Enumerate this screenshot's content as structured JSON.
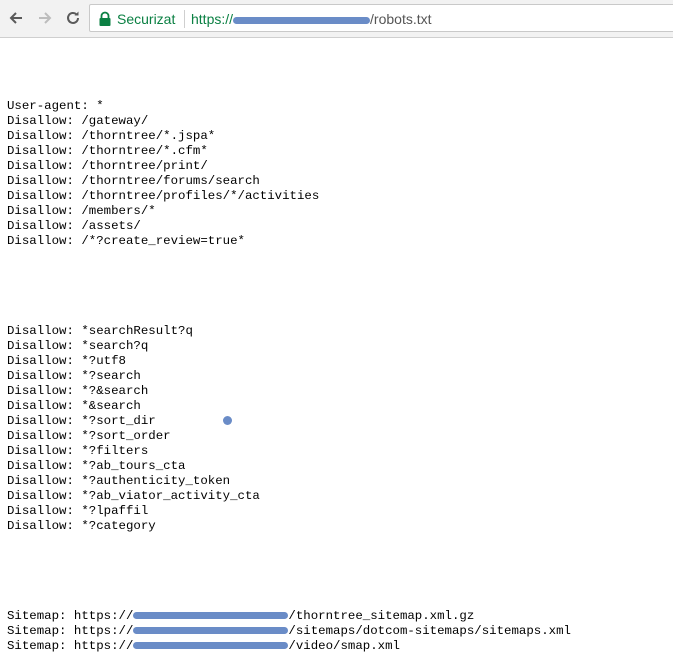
{
  "browser": {
    "security_label": "Securizat",
    "url_scheme": "https://",
    "url_path": "/robots.txt",
    "colors": {
      "secure": "#0b8043",
      "redaction": "#6a8cc7"
    },
    "icons": [
      "back-arrow-icon",
      "forward-arrow-icon",
      "reload-icon",
      "lock-icon"
    ]
  },
  "robots": {
    "block1": [
      "User-agent: *",
      "Disallow: /gateway/",
      "Disallow: /thorntree/*.jspa*",
      "Disallow: /thorntree/*.cfm*",
      "Disallow: /thorntree/print/",
      "Disallow: /thorntree/forums/search",
      "Disallow: /thorntree/profiles/*/activities",
      "Disallow: /members/*",
      "Disallow: /assets/",
      "Disallow: /*?create_review=true*"
    ],
    "block2": [
      "Disallow: *searchResult?q",
      "Disallow: *search?q",
      "Disallow: *?utf8",
      "Disallow: *?search",
      "Disallow: *?&search",
      "Disallow: *&search",
      "Disallow: *?sort_dir",
      "Disallow: *?sort_order",
      "Disallow: *?filters",
      "Disallow: *?ab_tours_cta",
      "Disallow: *?authenticity_token",
      "Disallow: *?ab_viator_activity_cta",
      "Disallow: *?lpaffil",
      "Disallow: *?category"
    ],
    "sitemaps": [
      {
        "prefix": "Sitemap: https://",
        "suffix": "/thorntree_sitemap.xml.gz"
      },
      {
        "prefix": "Sitemap: https://",
        "suffix": "/sitemaps/dotcom-sitemaps/sitemaps.xml"
      },
      {
        "prefix": "Sitemap: https://",
        "suffix": "/video/smap.xml"
      }
    ]
  }
}
